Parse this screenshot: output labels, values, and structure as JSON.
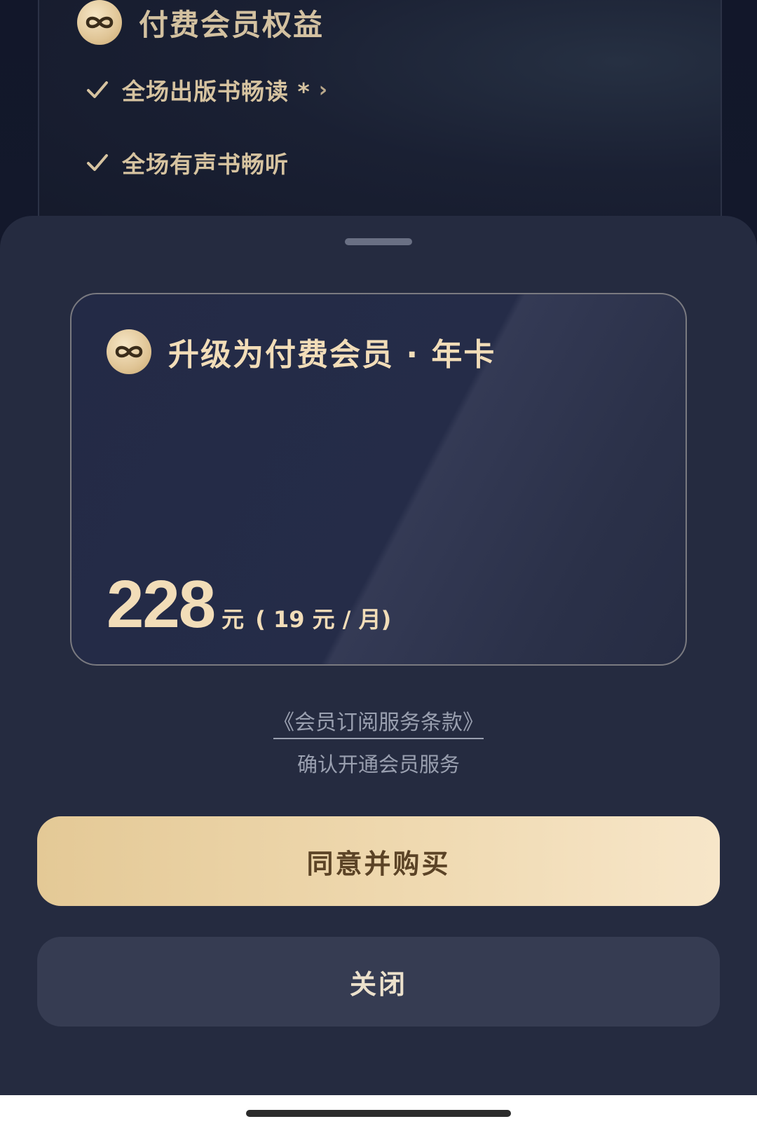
{
  "background_card": {
    "title": "付费会员权益",
    "benefits": [
      {
        "label": "全场出版书畅读 *",
        "has_arrow": true
      },
      {
        "label": "全场有声书畅听",
        "has_arrow": false
      }
    ],
    "arrow_glyph": "›"
  },
  "sheet": {
    "plan_card": {
      "title": "升级为付费会员 · 年卡",
      "price": "228",
      "unit": "元",
      "monthly": "( 19 元 / 月)"
    },
    "terms_link": "《会员订阅服务条款》",
    "confirm_text": "确认开通会员服务",
    "buy_button": "同意并购买",
    "close_button": "关闭"
  },
  "colors": {
    "gold": "#f2ddb8",
    "sheet_bg": "#252b40",
    "button_gold_start": "#e4c996",
    "button_gold_end": "#f7e6c9"
  },
  "icons": {
    "logo": "infinity-icon",
    "check": "check-icon"
  }
}
